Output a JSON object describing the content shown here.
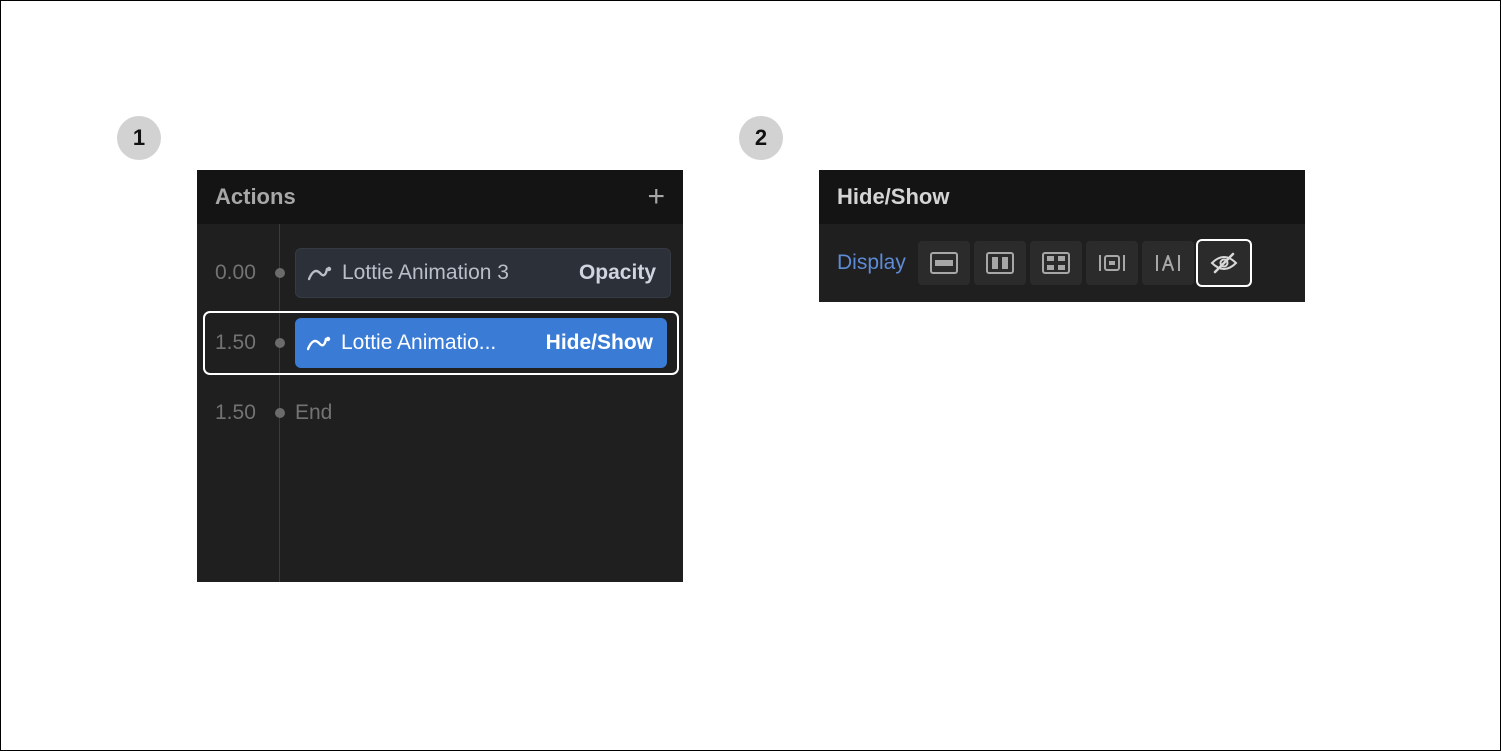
{
  "badges": {
    "b1": "1",
    "b2": "2"
  },
  "panel1": {
    "title": "Actions",
    "rows": [
      {
        "time": "0.00",
        "name": "Lottie Animation 3",
        "prop": "Opacity",
        "selected": false
      },
      {
        "time": "1.50",
        "name": "Lottie Animatio...",
        "prop": "Hide/Show",
        "selected": true
      }
    ],
    "end": {
      "time": "1.50",
      "label": "End"
    }
  },
  "panel2": {
    "title": "Hide/Show",
    "label": "Display",
    "options": [
      {
        "id": "block"
      },
      {
        "id": "flex"
      },
      {
        "id": "grid"
      },
      {
        "id": "inline-block"
      },
      {
        "id": "inline"
      },
      {
        "id": "none",
        "selected": true
      }
    ]
  }
}
